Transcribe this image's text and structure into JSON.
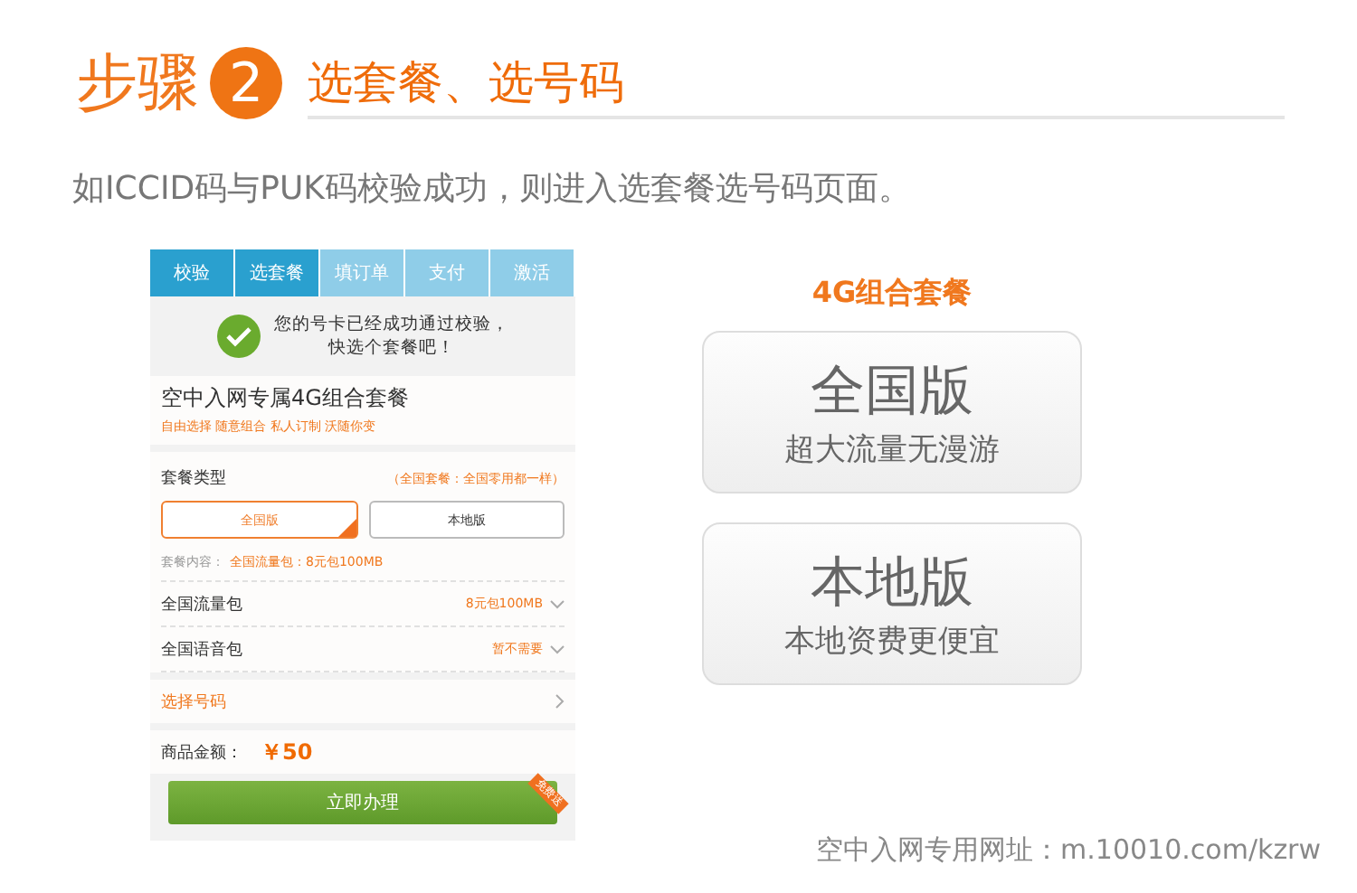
{
  "header": {
    "step_label": "步骤",
    "step_number": "2",
    "title": "选套餐、选号码"
  },
  "description": "如ICCID码与PUK码校验成功，则进入选套餐选号码页面。",
  "phone": {
    "steps": [
      {
        "label": "校验",
        "done": true
      },
      {
        "label": "选套餐",
        "done": true
      },
      {
        "label": "填订单",
        "done": false
      },
      {
        "label": "支付",
        "done": false
      },
      {
        "label": "激活",
        "done": false
      }
    ],
    "success_message": [
      "您的号卡已经成功通过校验，",
      "快选个套餐吧！"
    ],
    "plan_title": "空中入网专属4G组合套餐",
    "plan_tagline": "自由选择 随意组合 私人订制 沃随你变",
    "type_label": "套餐类型",
    "type_note": "（全国套餐：全国零用都一样）",
    "options": [
      {
        "label": "全国版",
        "selected": true
      },
      {
        "label": "本地版",
        "selected": false
      }
    ],
    "content_label": "套餐内容：",
    "content_value": "全国流量包：8元包100MB",
    "packages": [
      {
        "name": "全国流量包",
        "value": "8元包100MB"
      },
      {
        "name": "全国语音包",
        "value": "暂不需要"
      }
    ],
    "choose_number": "选择号码",
    "price_label": "商品金额：",
    "price": "￥50",
    "submit": "立即办理",
    "ribbon": "免费送"
  },
  "combo": {
    "title": "4G组合套餐",
    "cards": [
      {
        "name": "全国版",
        "desc": "超大流量无漫游"
      },
      {
        "name": "本地版",
        "desc": "本地资费更便宜"
      }
    ]
  },
  "footer": {
    "label": "空中入网专用网址：",
    "url": "m.10010.com/kzrw"
  }
}
